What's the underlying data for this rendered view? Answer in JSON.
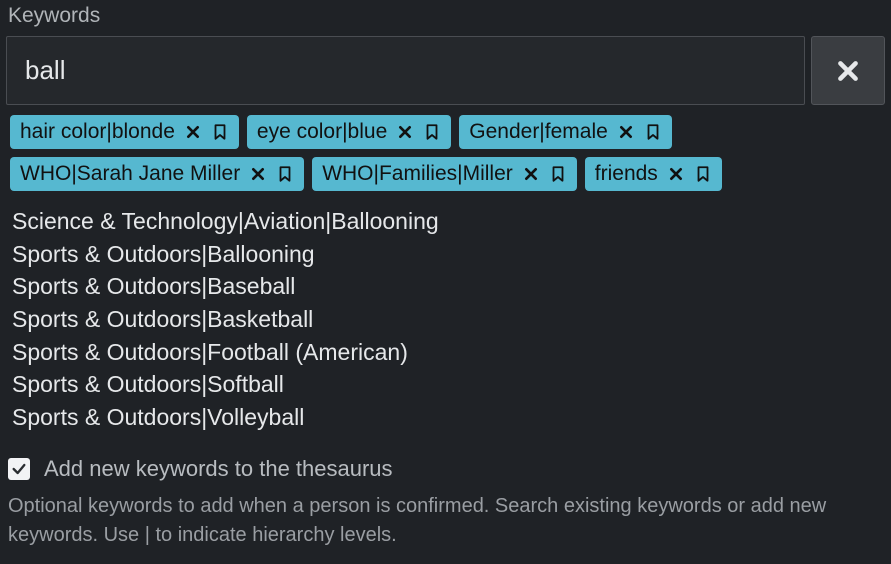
{
  "field": {
    "label": "Keywords",
    "search_value": "ball"
  },
  "tags": [
    {
      "label": "hair color|blonde"
    },
    {
      "label": "eye color|blue"
    },
    {
      "label": "Gender|female"
    },
    {
      "label": "WHO|Sarah Jane Miller"
    },
    {
      "label": "WHO|Families|Miller"
    },
    {
      "label": "friends"
    }
  ],
  "suggestions": [
    "Science & Technology|Aviation|Ballooning",
    "Sports & Outdoors|Ballooning",
    "Sports & Outdoors|Baseball",
    "Sports & Outdoors|Basketball",
    "Sports & Outdoors|Football (American)",
    "Sports & Outdoors|Softball",
    "Sports & Outdoors|Volleyball"
  ],
  "thesaurus": {
    "checked": true,
    "label": "Add new keywords to the thesaurus"
  },
  "help": "Optional keywords to add when a person is confirmed. Search existing keywords or add new keywords. Use | to indicate hierarchy levels."
}
